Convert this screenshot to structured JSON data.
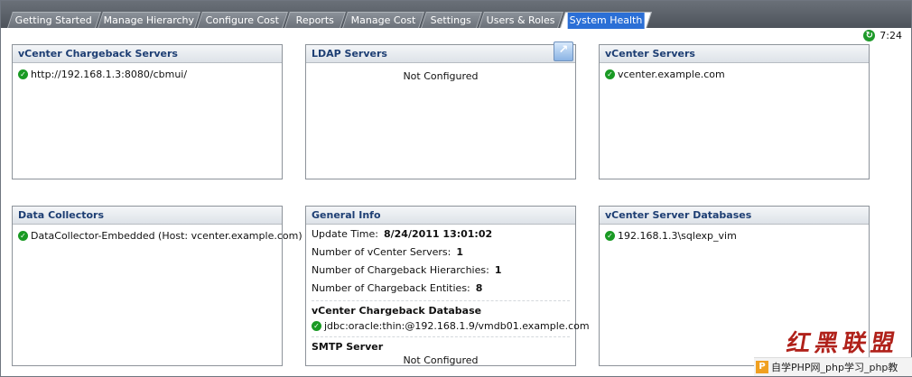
{
  "tabs": [
    {
      "label": "Getting Started"
    },
    {
      "label": "Manage Hierarchy"
    },
    {
      "label": "Configure Cost"
    },
    {
      "label": "Reports"
    },
    {
      "label": "Manage Cost"
    },
    {
      "label": "Settings"
    },
    {
      "label": "Users & Roles"
    },
    {
      "label": "System Health",
      "active": true
    }
  ],
  "clock": {
    "time": "7:24",
    "icon": "refresh-icon"
  },
  "panels": {
    "chargeback_servers": {
      "title": "vCenter Chargeback Servers",
      "items": [
        "http://192.168.1.3:8080/cbmui/"
      ]
    },
    "ldap_servers": {
      "title": "LDAP Servers",
      "status": "Not Configured",
      "icon": "expand-icon"
    },
    "vcenter_servers": {
      "title": "vCenter Servers",
      "items": [
        "vcenter.example.com"
      ]
    },
    "data_collectors": {
      "title": "Data Collectors",
      "items": [
        "DataCollector-Embedded (Host: vcenter.example.com)"
      ]
    },
    "general_info": {
      "title": "General Info",
      "update_time_label": "Update Time:",
      "update_time_value": "8/24/2011 13:01:02",
      "vc_servers_label": "Number of vCenter Servers:",
      "vc_servers_value": "1",
      "hierarchies_label": "Number of Chargeback Hierarchies:",
      "hierarchies_value": "1",
      "entities_label": "Number of Chargeback Entities:",
      "entities_value": "8",
      "db_title": "vCenter Chargeback Database",
      "db_value": "jdbc:oracle:thin:@192.168.1.9/vmdb01.example.com",
      "smtp_title": "SMTP Server",
      "smtp_value": "Not Configured"
    },
    "vc_databases": {
      "title": "vCenter Server Databases",
      "items": [
        "192.168.1.3\\sqlexp_vim"
      ]
    }
  },
  "watermark": {
    "text": "红黑联盟",
    "footer": "自学PHP网_php学习_php教"
  },
  "colors": {
    "status_ok": "#1a9a24",
    "panel_title": "#1d3e73",
    "active_tab_highlight": "#2b6fd6"
  }
}
